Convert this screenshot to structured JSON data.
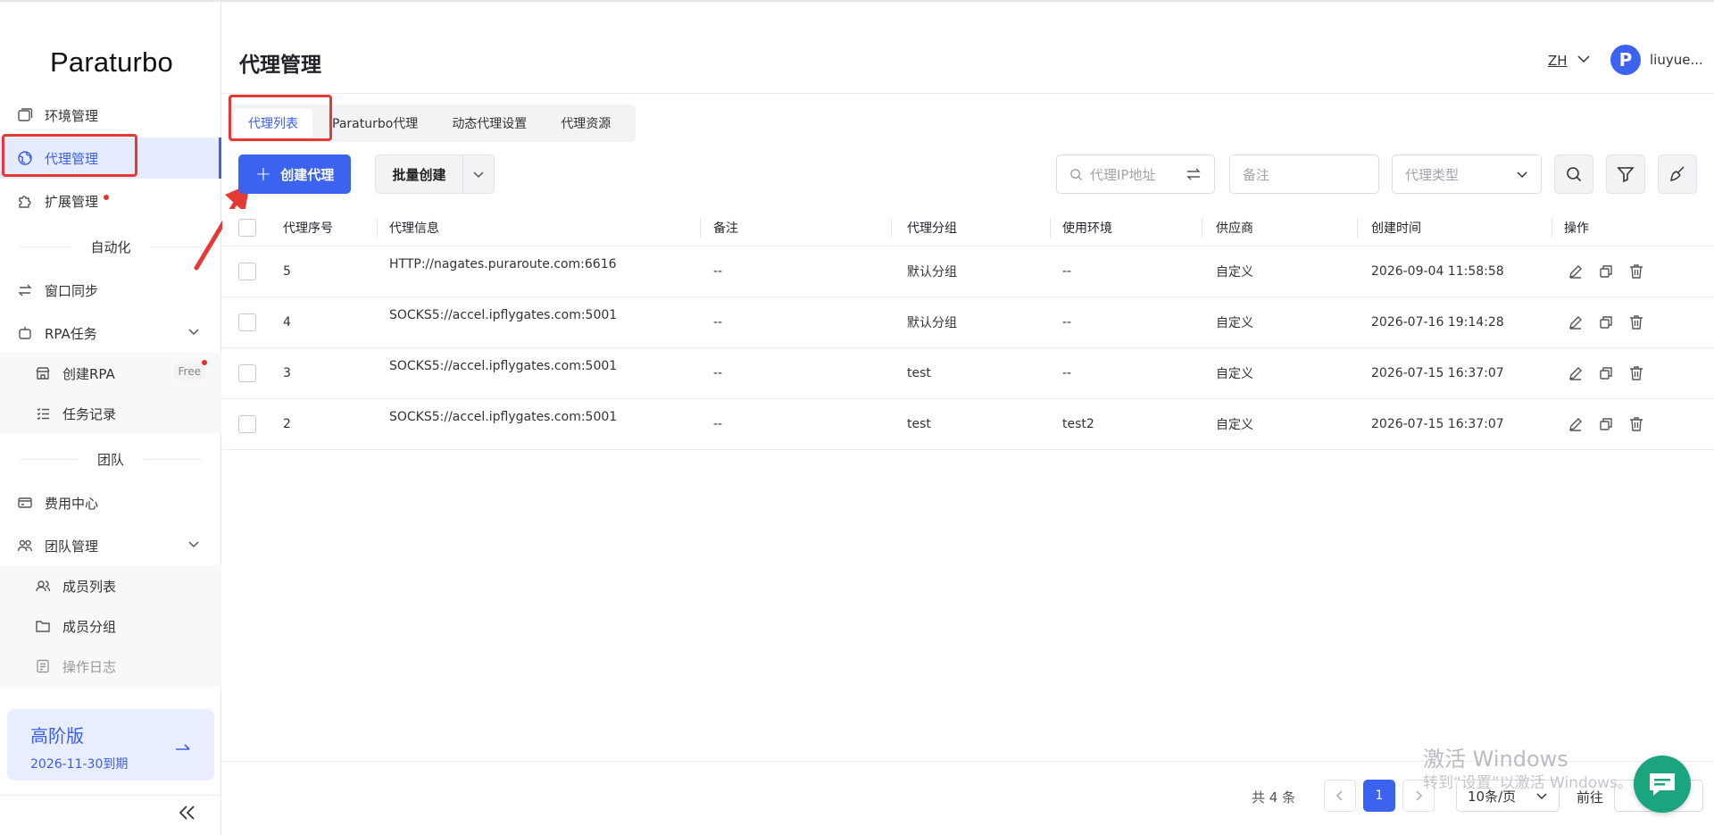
{
  "logo": "Paraturbo",
  "sidebar": {
    "items": [
      {
        "label": "环境管理",
        "icon": "window-icon"
      },
      {
        "label": "代理管理",
        "icon": "globe-icon"
      },
      {
        "label": "扩展管理",
        "icon": "puzzle-icon"
      }
    ],
    "automation_title": "自动化",
    "automation": [
      {
        "label": "窗口同步",
        "icon": "sync-icon"
      },
      {
        "label": "RPA任务",
        "icon": "robot-icon"
      },
      {
        "label": "创建RPA",
        "icon": "store-icon",
        "tag": "Free"
      },
      {
        "label": "任务记录",
        "icon": "checklist-icon"
      }
    ],
    "team_title": "团队",
    "team": [
      {
        "label": "费用中心",
        "icon": "wallet-icon"
      },
      {
        "label": "团队管理",
        "icon": "team-icon"
      },
      {
        "label": "成员列表",
        "icon": "users-icon"
      },
      {
        "label": "成员分组",
        "icon": "folder-icon"
      },
      {
        "label": "操作日志",
        "icon": "log-icon"
      }
    ],
    "plan": {
      "title": "高阶版",
      "expiry": "2026-11-30到期"
    }
  },
  "header": {
    "title": "代理管理",
    "lang": "ZH",
    "avatar": "P",
    "username": "liuyue..."
  },
  "tabs": [
    "代理列表",
    "Paraturbo代理",
    "动态代理设置",
    "代理资源"
  ],
  "toolbar": {
    "create_label": "创建代理",
    "batch_label": "批量创建",
    "ip_placeholder": "代理IP地址",
    "note_placeholder": "备注",
    "type_placeholder": "代理类型"
  },
  "table": {
    "headers": [
      "代理序号",
      "代理信息",
      "备注",
      "代理分组",
      "使用环境",
      "供应商",
      "创建时间",
      "操作"
    ],
    "rows": [
      {
        "id": "5",
        "info": "HTTP://nagates.puraroute.com:6616",
        "note": "--",
        "group": "默认分组",
        "env": "--",
        "vendor": "自定义",
        "time": "2026-09-04 11:58:58"
      },
      {
        "id": "4",
        "info": "SOCKS5://accel.ipflygates.com:5001",
        "note": "--",
        "group": "默认分组",
        "env": "--",
        "vendor": "自定义",
        "time": "2026-07-16 19:14:28"
      },
      {
        "id": "3",
        "info": "SOCKS5://accel.ipflygates.com:5001",
        "note": "--",
        "group": "test",
        "env": "--",
        "vendor": "自定义",
        "time": "2026-07-15 16:37:07"
      },
      {
        "id": "2",
        "info": "SOCKS5://accel.ipflygates.com:5001",
        "note": "--",
        "group": "test",
        "env": "test2",
        "vendor": "自定义",
        "time": "2026-07-15 16:37:07"
      }
    ]
  },
  "pagination": {
    "total": "共 4 条",
    "current": "1",
    "size": "10条/页",
    "goto": "前往"
  },
  "watermark": {
    "line1": "激活 Windows",
    "line2": "转到“设置”以激活 Windows。"
  },
  "colors": {
    "primary": "#3b63f0",
    "annotation": "#e53935",
    "chat": "#1aa57f"
  }
}
